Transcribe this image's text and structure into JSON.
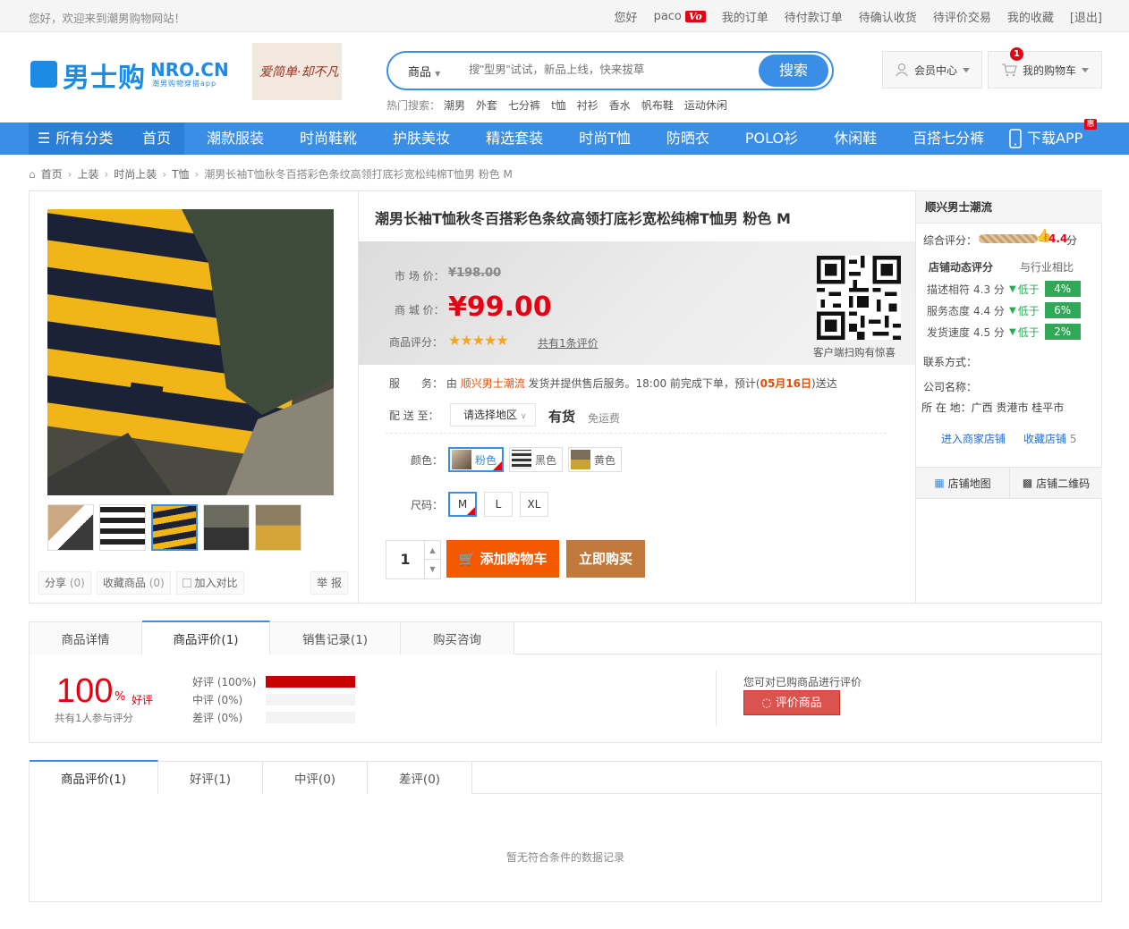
{
  "topbar": {
    "welcome": "您好，欢迎来到潮男购物网站！",
    "links": [
      "您好",
      "paco",
      "我的订单",
      "待付款订单",
      "待确认收货",
      "待评价交易",
      "我的收藏",
      "[退出]"
    ],
    "vo": "Vo"
  },
  "logo": {
    "main": "男士购",
    "domain": "NRO.CN",
    "sub": "潮男购物穿搭app"
  },
  "promo": {
    "text": "爱简单·却不凡"
  },
  "search": {
    "category": "商品",
    "placeholder": "搜\"型男\"试试，新品上线，快来拔草",
    "button": "搜索",
    "hot_label": "热门搜索：",
    "hot": [
      "潮男",
      "外套",
      "七分裤",
      "t恤",
      "衬衫",
      "香水",
      "帆布鞋",
      "运动休闲"
    ]
  },
  "header": {
    "member": "会员中心",
    "cart": "我的购物车",
    "cart_count": "1"
  },
  "nav": {
    "all": "所有分类",
    "items": [
      "首页",
      "潮款服装",
      "时尚鞋靴",
      "护肤美妆",
      "精选套装",
      "时尚T恤",
      "防晒衣",
      "POLO衫",
      "休闲鞋",
      "百搭七分裤"
    ],
    "app": "下载APP",
    "badge": "惠"
  },
  "breadcrumb": [
    "首页",
    "上装",
    "时尚上装",
    "T恤",
    "潮男长袖T恤秋冬百搭彩色条纹高领打底衫宽松纯棉T恤男 粉色 M"
  ],
  "product": {
    "title": "潮男长袖T恤秋冬百搭彩色条纹高领打底衫宽松纯棉T恤男 粉色 M",
    "market_label": "市 场 价：",
    "market_price": "¥198.00",
    "mall_label": "商 城 价：",
    "mall_price": "¥99.00",
    "rating_label": "商品评分：",
    "stars": "★★★★★",
    "review_link": "共有1条评价",
    "qr_caption": "客户端扫购有惊喜",
    "service_label": "服　　务：",
    "service_pre": "由",
    "service_shop": "顺兴男士潮流",
    "service_mid": "发货并提供售后服务。18:00 前完成下单，预计(",
    "service_date": "05月16日",
    "service_post": ")送达",
    "ship_label": "配 送 至：",
    "region": "请选择地区",
    "stock": "有货",
    "freeship": "免运费",
    "color_label": "颜色：",
    "colors": [
      "粉色",
      "黑色",
      "黄色"
    ],
    "size_label": "尺码：",
    "sizes": [
      "M",
      "L",
      "XL"
    ],
    "qty": "1",
    "add_cart": "添加购物车",
    "buy_now": "立即购买"
  },
  "gallery_actions": {
    "share": "分享",
    "share_count": "(0)",
    "fav": "收藏商品",
    "fav_count": "(0)",
    "compare": "加入对比",
    "report": "举 报"
  },
  "shop": {
    "name": "顺兴男士潮流",
    "score_label": "综合评分：",
    "score": "4.4",
    "score_unit": "分",
    "dyn_head": "店铺动态评分",
    "dyn_cmp": "与行业相比",
    "rows": [
      {
        "label": "描述相符",
        "score": "4.3 分",
        "cmp": "低于",
        "pct": "4%"
      },
      {
        "label": "服务态度",
        "score": "4.4 分",
        "cmp": "低于",
        "pct": "6%"
      },
      {
        "label": "发货速度",
        "score": "4.5 分",
        "cmp": "低于",
        "pct": "2%"
      }
    ],
    "contact": "联系方式：",
    "company": "公司名称：",
    "location": "所 在 地：广西 贵港市 桂平市",
    "enter": "进入商家店铺",
    "collect": "收藏店铺",
    "collect_count": "5",
    "map": "店铺地图",
    "qrcode": "店铺二维码"
  },
  "detail_tabs": [
    "商品详情",
    "商品评价(1)",
    "销售记录(1)",
    "购买咨询"
  ],
  "rating": {
    "pct": "100",
    "pct_sign": "%",
    "good_label": "好评",
    "participants": "共有1人参与评分",
    "rows": [
      {
        "label": "好评 (100%)",
        "fill": 1.0
      },
      {
        "label": "中评 (0%)",
        "fill": 0
      },
      {
        "label": "差评 (0%)",
        "fill": 0
      }
    ],
    "can_review": "您可对已购商品进行评价",
    "review_btn": "评价商品"
  },
  "review_tabs": [
    "商品评价(1)",
    "好评(1)",
    "中评(0)",
    "差评(0)"
  ],
  "empty": "暂无符合条件的数据记录",
  "colors": {
    "accent": "#3a8ee6",
    "price": "#e60012",
    "cart": "#f35a00",
    "buy": "#c17a3c",
    "green": "#2eaa57"
  }
}
